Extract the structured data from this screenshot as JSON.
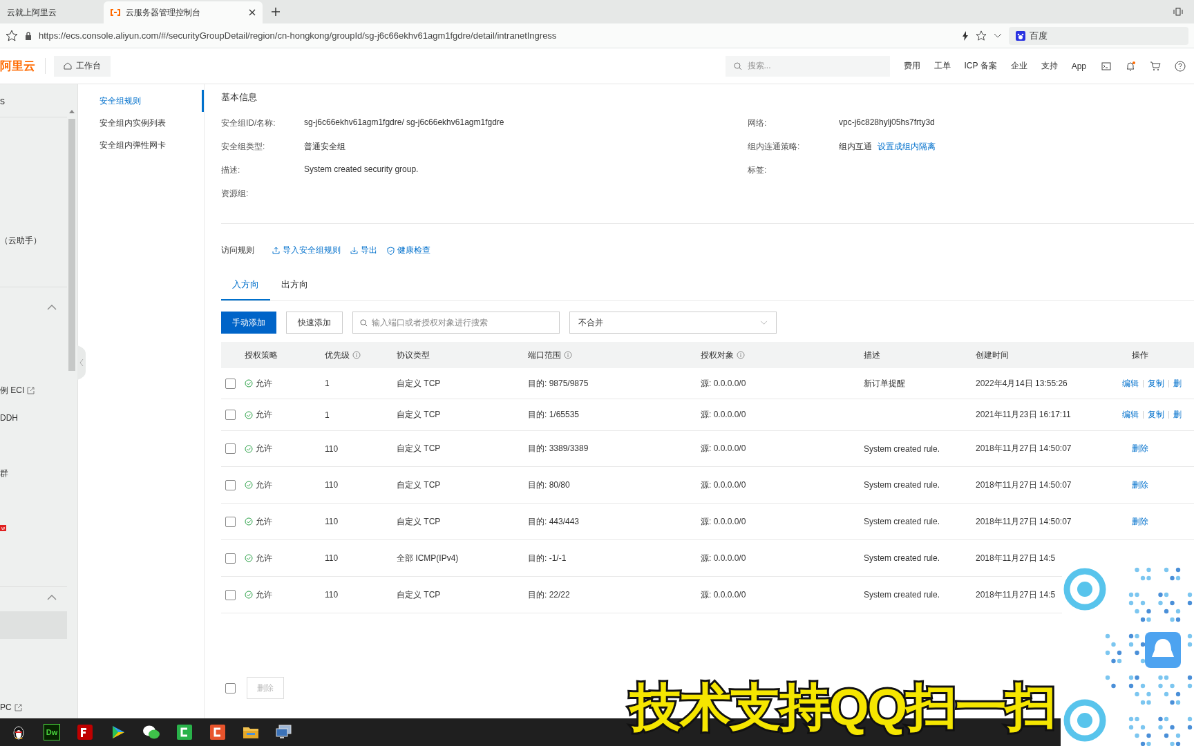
{
  "browser": {
    "tabs": [
      {
        "label": "云就上阿里云",
        "selected": false
      },
      {
        "label": "云服务器管理控制台",
        "selected": true
      }
    ],
    "url": "https://ecs.console.aliyun.com/#/securityGroupDetail/region/cn-hongkong/groupId/sg-j6c66ekhv61agm1fgdre/detail/intranetIngress",
    "search_engine": "百度"
  },
  "header": {
    "logo": "阿里云",
    "workbench": "工作台",
    "search": {
      "placeholder": "搜索..."
    },
    "nav": [
      "费用",
      "工单",
      "ICP 备案",
      "企业",
      "支持",
      "App"
    ]
  },
  "sidebar": {
    "title": "s",
    "items": [
      {
        "label": "（云助手）",
        "kind": "text"
      },
      {
        "label": "例 ECI",
        "kind": "external"
      },
      {
        "label": "DDH",
        "kind": "text"
      },
      {
        "label": "群",
        "kind": "text"
      },
      {
        "label": "w",
        "kind": "badge"
      },
      {
        "label": "PC",
        "kind": "external"
      }
    ]
  },
  "subnav": [
    {
      "label": "安全组规则",
      "selected": true
    },
    {
      "label": "安全组内实例列表",
      "selected": false
    },
    {
      "label": "安全组内弹性网卡",
      "selected": false
    }
  ],
  "basic_info": {
    "title": "基本信息",
    "fields": [
      {
        "label": "安全组ID/名称:",
        "value": "sg-j6c66ekhv61agm1fgdre/ sg-j6c66ekhv61agm1fgdre"
      },
      {
        "label": "网络:",
        "value": "vpc-j6c828hylj05hs7frty3d"
      },
      {
        "label": "安全组类型:",
        "value": "普通安全组"
      },
      {
        "label": "组内连通策略:",
        "value": "组内互通",
        "link": "设置成组内隔离"
      },
      {
        "label": "描述:",
        "value": "System created security group."
      },
      {
        "label": "标签:"
      },
      {
        "label": "资源组:"
      }
    ]
  },
  "rules": {
    "title": "访问规则",
    "actions": [
      "导入安全组规则",
      "导出",
      "健康检查"
    ],
    "tabs": [
      {
        "label": "入方向",
        "selected": true
      },
      {
        "label": "出方向",
        "selected": false
      }
    ],
    "add_button": "手动添加",
    "quick_add_button": "快速添加",
    "search": {
      "placeholder": "输入端口或者授权对象进行搜索"
    },
    "merge_select": "不合并",
    "columns": [
      "授权策略",
      "优先级",
      "协议类型",
      "端口范围",
      "授权对象",
      "描述",
      "创建时间",
      "操作"
    ],
    "rows": [
      {
        "checked": false,
        "policy": "允许",
        "priority": "1",
        "protocol": "自定义 TCP",
        "port": "目的: 9875/9875",
        "source": "源: 0.0.0.0/0",
        "desc": "新订单提醒",
        "time": "2022年4月14日 13:55:26",
        "actions": [
          "编辑",
          "复制",
          "删"
        ]
      },
      {
        "checked": false,
        "policy": "允许",
        "priority": "1",
        "protocol": "自定义 TCP",
        "port": "目的: 1/65535",
        "source": "源: 0.0.0.0/0",
        "time": "2021年11月23日 16:17:11",
        "actions": [
          "编辑",
          "复制",
          "删"
        ]
      },
      {
        "checked": false,
        "policy": "允许",
        "priority": "110",
        "protocol": "自定义 TCP",
        "port": "目的: 3389/3389",
        "source": "源: 0.0.0.0/0",
        "desc": "System created rule.",
        "time": "2018年11月27日 14:50:07",
        "actions": [
          "删除"
        ]
      },
      {
        "checked": false,
        "policy": "允许",
        "priority": "110",
        "protocol": "自定义 TCP",
        "port": "目的: 80/80",
        "source": "源: 0.0.0.0/0",
        "desc": "System created rule.",
        "time": "2018年11月27日 14:50:07",
        "actions": [
          "删除"
        ]
      },
      {
        "checked": false,
        "policy": "允许",
        "priority": "110",
        "protocol": "自定义 TCP",
        "port": "目的: 443/443",
        "source": "源: 0.0.0.0/0",
        "desc": "System created rule.",
        "time": "2018年11月27日 14:50:07",
        "actions": [
          "删除"
        ]
      },
      {
        "checked": false,
        "policy": "允许",
        "priority": "110",
        "protocol": "全部 ICMP(IPv4)",
        "port": "目的: -1/-1",
        "source": "源: 0.0.0.0/0",
        "desc": "System created rule.",
        "time": "2018年11月27日 14:5"
      },
      {
        "checked": false,
        "policy": "允许",
        "priority": "110",
        "protocol": "自定义 TCP",
        "port": "目的: 22/22",
        "source": "源: 0.0.0.0/0",
        "desc": "System created rule.",
        "time": "2018年11月27日 14:5"
      }
    ],
    "footer": {
      "checked": false,
      "delete_button": "删除"
    }
  },
  "taskbar": [
    {
      "kind": "penguin"
    },
    {
      "kind": "dw",
      "label": "Dw"
    },
    {
      "kind": "fz"
    },
    {
      "kind": "play"
    },
    {
      "kind": "chat"
    },
    {
      "kind": "green"
    },
    {
      "kind": "orange"
    },
    {
      "kind": "folder"
    },
    {
      "kind": "monitor"
    }
  ],
  "overlay": {
    "caption": "技术支持QQ扫一扫"
  }
}
